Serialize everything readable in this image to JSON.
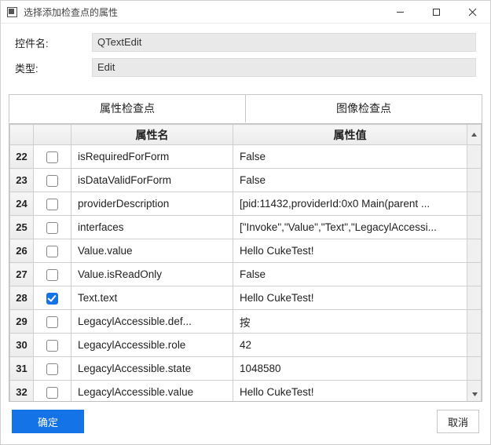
{
  "window": {
    "title": "选择添加检查点的属性"
  },
  "form": {
    "control_name_label": "控件名:",
    "control_name_value": "QTextEdit",
    "type_label": "类型:",
    "type_value": "Edit"
  },
  "tabs": {
    "attr_checkpoint": "属性检查点",
    "image_checkpoint": "图像检查点",
    "active_index": 0
  },
  "table": {
    "header_name": "属性名",
    "header_value": "属性值",
    "rows": [
      {
        "num": "22",
        "checked": false,
        "name": "isRequiredForForm",
        "value": "False"
      },
      {
        "num": "23",
        "checked": false,
        "name": "isDataValidForForm",
        "value": "False"
      },
      {
        "num": "24",
        "checked": false,
        "name": "providerDescription",
        "value": "[pid:11432,providerId:0x0 Main(parent ..."
      },
      {
        "num": "25",
        "checked": false,
        "name": "interfaces",
        "value": "[\"Invoke\",\"Value\",\"Text\",\"LegacylAccessi..."
      },
      {
        "num": "26",
        "checked": false,
        "name": "Value.value",
        "value": "Hello CukeTest!"
      },
      {
        "num": "27",
        "checked": false,
        "name": "Value.isReadOnly",
        "value": "False"
      },
      {
        "num": "28",
        "checked": true,
        "name": "Text.text",
        "value": "Hello CukeTest!"
      },
      {
        "num": "29",
        "checked": false,
        "name": "LegacylAccessible.def...",
        "value": "按"
      },
      {
        "num": "30",
        "checked": false,
        "name": "LegacylAccessible.role",
        "value": "42"
      },
      {
        "num": "31",
        "checked": false,
        "name": "LegacylAccessible.state",
        "value": "1048580"
      },
      {
        "num": "32",
        "checked": false,
        "name": "LegacylAccessible.value",
        "value": "Hello CukeTest!"
      }
    ]
  },
  "buttons": {
    "ok": "确定",
    "cancel": "取消"
  }
}
